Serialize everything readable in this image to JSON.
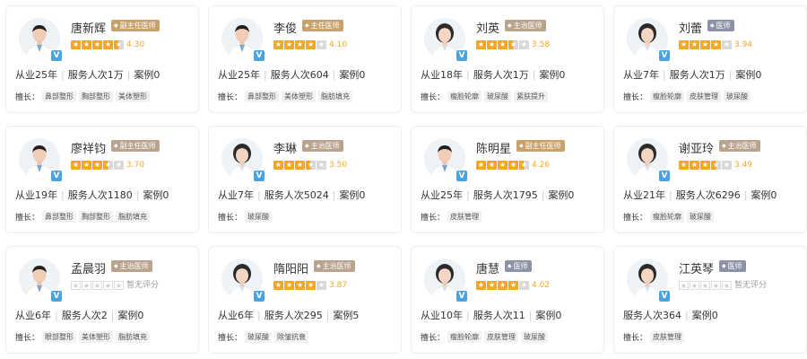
{
  "colors": {
    "star": "#f5a623",
    "star_empty": "#d9d9d9",
    "badge_deputy": "#c8a26a",
    "badge_attending": "#b9a38c",
    "badge_doctor": "#8d93a6",
    "verified": "#4aa3e0"
  },
  "icons": {
    "verified": "verified-v-icon",
    "title_marker": "diamond-icon",
    "rating": "star-icon"
  },
  "doctors": [
    {
      "name": "唐新辉",
      "title": "副主任医师",
      "badge": "fu",
      "rating": 4.3,
      "score": "4.30",
      "stats": [
        "从业25年",
        "服务人次1万",
        "案例0"
      ],
      "skills_label": "擅长：",
      "skills": [
        "鼻部整形",
        "胸部整形",
        "美体塑形"
      ],
      "gender": "m"
    },
    {
      "name": "李俊",
      "title": "主任医师",
      "badge": "fu",
      "rating": 4.1,
      "score": "4.10",
      "stats": [
        "从业25年",
        "服务人次604",
        "案例0"
      ],
      "skills_label": "擅长：",
      "skills": [
        "鼻部整形",
        "美体塑形",
        "脂肪填充"
      ],
      "gender": "m"
    },
    {
      "name": "刘英",
      "title": "主治医师",
      "badge": "zhu",
      "rating": 3.58,
      "score": "3.58",
      "stats": [
        "从业18年",
        "服务人次1万",
        "案例0"
      ],
      "skills_label": "擅长：",
      "skills": [
        "瘦脸轮廓",
        "玻尿酸",
        "紧肤提升"
      ],
      "gender": "f"
    },
    {
      "name": "刘蕾",
      "title": "医师",
      "badge": "yi",
      "rating": 3.94,
      "score": "3.94",
      "stats": [
        "从业7年",
        "服务人次1万",
        "案例0"
      ],
      "skills_label": "擅长：",
      "skills": [
        "瘦脸轮廓",
        "皮肤管理",
        "玻尿酸"
      ],
      "gender": "f"
    },
    {
      "name": "廖祥钧",
      "title": "副主任医师",
      "badge": "zhu",
      "rating": 3.7,
      "score": "3.70",
      "stats": [
        "从业19年",
        "服务人次1180",
        "案例0"
      ],
      "skills_label": "擅长：",
      "skills": [
        "鼻部整形",
        "胸部整形",
        "脂肪填充"
      ],
      "gender": "m"
    },
    {
      "name": "李琳",
      "title": "主治医师",
      "badge": "zhu",
      "rating": 3.5,
      "score": "3.50",
      "stats": [
        "从业7年",
        "服务人次5024",
        "案例0"
      ],
      "skills_label": "擅长：",
      "skills": [
        "玻尿酸"
      ],
      "gender": "f"
    },
    {
      "name": "陈明星",
      "title": "副主任医师",
      "badge": "fu",
      "rating": 4.26,
      "score": "4.26",
      "stats": [
        "从业25年",
        "服务人次1795",
        "案例0"
      ],
      "skills_label": "擅长：",
      "skills": [
        "皮肤管理"
      ],
      "gender": "m"
    },
    {
      "name": "谢亚玲",
      "title": "主治医师",
      "badge": "zhu",
      "rating": 3.49,
      "score": "3.49",
      "stats": [
        "从业21年",
        "服务人次6296",
        "案例0"
      ],
      "skills_label": "擅长：",
      "skills": [
        "瘦脸轮廓",
        "玻尿酸"
      ],
      "gender": "f"
    },
    {
      "name": "孟晨羽",
      "title": "主治医师",
      "badge": "zhu",
      "rating": 0,
      "score": "暂无评分",
      "stats": [
        "从业6年",
        "服务人次2",
        "案例0"
      ],
      "skills_label": "擅长：",
      "skills": [
        "眼部整形",
        "美体塑形",
        "脂肪填充"
      ],
      "gender": "m"
    },
    {
      "name": "隋阳阳",
      "title": "主治医师",
      "badge": "zhu",
      "rating": 3.87,
      "score": "3.87",
      "stats": [
        "从业6年",
        "服务人次295",
        "案例5"
      ],
      "skills_label": "擅长：",
      "skills": [
        "玻尿酸",
        "除皱抗衰"
      ],
      "gender": "f"
    },
    {
      "name": "唐慧",
      "title": "医师",
      "badge": "yi",
      "rating": 4.02,
      "score": "4.02",
      "stats": [
        "从业10年",
        "服务人次11",
        "案例0"
      ],
      "skills_label": "擅长：",
      "skills": [
        "瘦脸轮廓",
        "皮肤管理",
        "玻尿酸"
      ],
      "gender": "f"
    },
    {
      "name": "江英琴",
      "title": "医师",
      "badge": "yi",
      "rating": 0,
      "score": "暂无评分",
      "stats": [
        "服务人次364",
        "案例0"
      ],
      "skills_label": "擅长：",
      "skills": [
        "皮肤管理"
      ],
      "gender": "f"
    }
  ]
}
